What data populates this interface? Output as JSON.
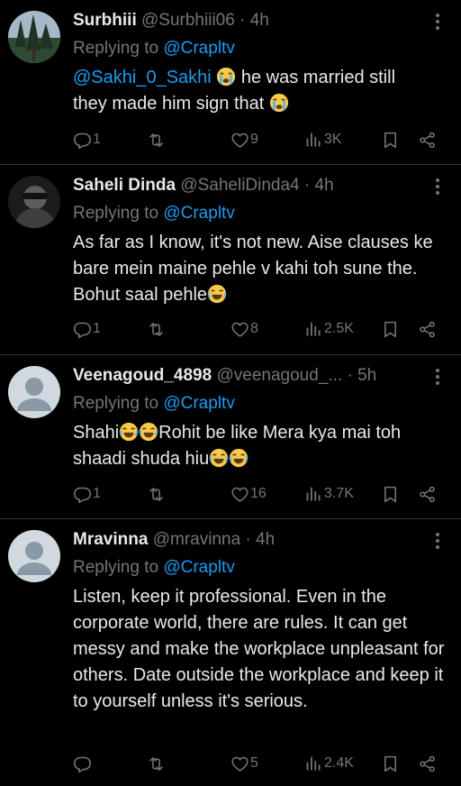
{
  "tweets": [
    {
      "name": "Surbhiii",
      "handle": "@Surbhiii06",
      "dot": "·",
      "time": "4h",
      "replying_prefix": "Replying to ",
      "replying_to": "@Crapltv",
      "mention": "@Sakhi_0_Sakhi",
      "text_a": " he was married still",
      "text_b": "they made him sign that ",
      "emoji": [
        "loudly-crying-face",
        "loudly-crying-face"
      ],
      "replies": "1",
      "retweets": "",
      "likes": "9",
      "views": "3K",
      "avatar": "tree-photo"
    },
    {
      "name": "Saheli Dinda",
      "handle": "@SaheliDinda4",
      "dot": "·",
      "time": "4h",
      "replying_prefix": "Replying to ",
      "replying_to": "@Crapltv",
      "text": "As far as I know, it's not new. Aise clauses ke bare mein maine pehle v kahi toh sune the. Bohut saal pehle",
      "emoji": [
        "face-with-tears-of-joy"
      ],
      "replies": "1",
      "retweets": "",
      "likes": "8",
      "views": "2.5K",
      "avatar": "person-photo"
    },
    {
      "name": "Veenagoud_4898",
      "handle": "@veenagoud_...",
      "dot": "·",
      "time": "5h",
      "replying_prefix": "Replying to ",
      "replying_to": "@Crapltv",
      "text_a": "Shahi",
      "text_b": "Rohit be like Mera kya mai toh",
      "text_c": "shaadi shuda hiu",
      "emoji": [
        "face-with-tears-of-joy",
        "face-with-tears-of-joy",
        "face-with-tears-of-joy",
        "face-with-tears-of-joy"
      ],
      "replies": "1",
      "retweets": "",
      "likes": "16",
      "views": "3.7K",
      "avatar": "default-avatar"
    },
    {
      "name": "Mravinna",
      "handle": "@mravinna",
      "dot": "·",
      "time": "4h",
      "replying_prefix": "Replying to ",
      "replying_to": "@Crapltv",
      "text": "Listen, keep it professional. Even in the corporate world, there are rules. It can get messy and make the workplace unpleasant for others. Date outside the workplace and keep it to yourself unless it's serious.",
      "replies": "",
      "retweets": "",
      "likes": "5",
      "views": "2.4K",
      "avatar": "default-avatar"
    }
  ],
  "colors": {
    "background": "#000000",
    "text": "#e7e9ea",
    "muted": "#71767b",
    "link": "#1d9bf0",
    "divider": "#2f3336"
  }
}
